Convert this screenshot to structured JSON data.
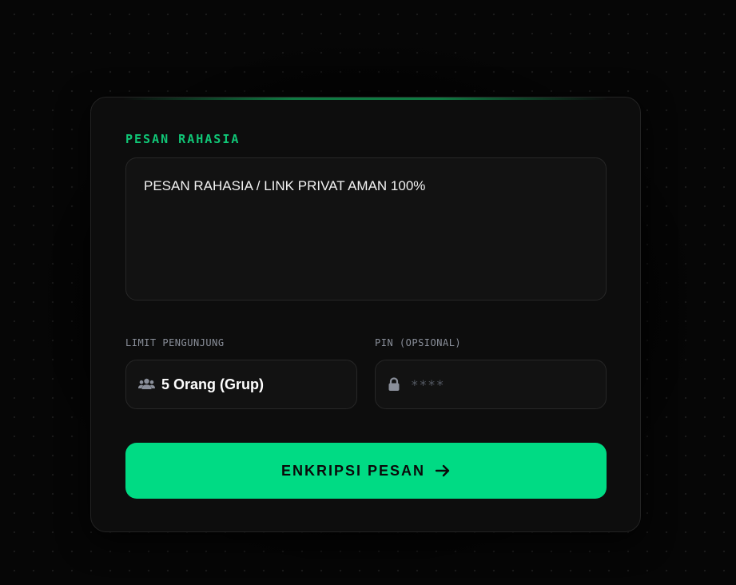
{
  "form": {
    "message_label": "PESAN RAHASIA",
    "message_value": "PESAN RAHASIA / LINK PRIVAT AMAN 100%",
    "limit_label": "LIMIT PENGUNJUNG",
    "limit_value": "5 Orang (Grup)",
    "limit_icon": "users-icon",
    "pin_label": "PIN (OPSIONAL)",
    "pin_placeholder": "****",
    "pin_icon": "lock-icon",
    "submit_label": "ENKRIPSI PESAN",
    "submit_icon": "arrow-right-icon"
  },
  "colors": {
    "accent": "#00db84",
    "label_accent": "#10c777",
    "background": "#060606",
    "card": "#0d0d0d"
  }
}
